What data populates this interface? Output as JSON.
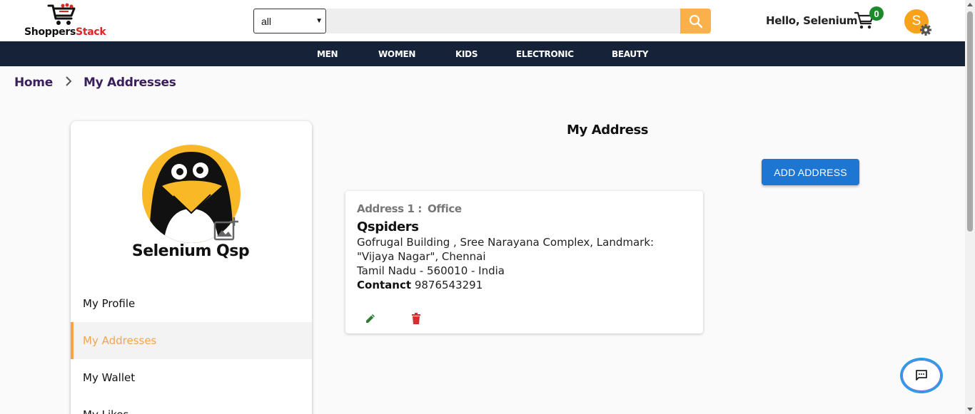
{
  "header": {
    "logo": {
      "part1": "Shoppers",
      "part2": "Stack"
    },
    "search": {
      "category_value": "all",
      "placeholder": "",
      "value": ""
    },
    "greeting": "Hello, Selenium",
    "cart_count": "0",
    "avatar_initial": "S"
  },
  "nav": {
    "items": [
      {
        "label": "MEN"
      },
      {
        "label": "WOMEN"
      },
      {
        "label": "KIDS"
      },
      {
        "label": "ELECTRONIC"
      },
      {
        "label": "BEAUTY"
      }
    ]
  },
  "breadcrumb": {
    "home": "Home",
    "current": "My Addresses"
  },
  "profile": {
    "name": "Selenium Qsp",
    "menu": [
      {
        "label": "My Profile"
      },
      {
        "label": "My Addresses"
      },
      {
        "label": "My Wallet"
      },
      {
        "label": "My Likes"
      }
    ]
  },
  "main": {
    "title": "My Address",
    "add_button": "ADD ADDRESS",
    "address": {
      "label": "Address 1 :",
      "type": "Office",
      "name": "Qspiders",
      "line1": "Gofrugal Building , Sree Narayana Complex, Landmark:",
      "line2": "\"Vijaya Nagar\", Chennai",
      "line3": "Tamil Nadu - 560010 - India",
      "contact_label": "Contanct",
      "contact_value": "9876543291"
    }
  },
  "colors": {
    "brand_accent": "#f6a44c",
    "navbar": "#162238",
    "primary_button": "#1e76d3",
    "edit_icon": "#2e7d32",
    "delete_icon": "#d32f2f",
    "cart_badge": "#1c8a2a"
  },
  "icons": {
    "logo": "shopping-cart-logo-icon",
    "search": "search-icon",
    "cart": "cart-icon",
    "settings": "gear-icon",
    "add_photo": "add-photo-icon",
    "edit": "pencil-icon",
    "delete": "trash-icon",
    "chat": "chat-icon"
  }
}
